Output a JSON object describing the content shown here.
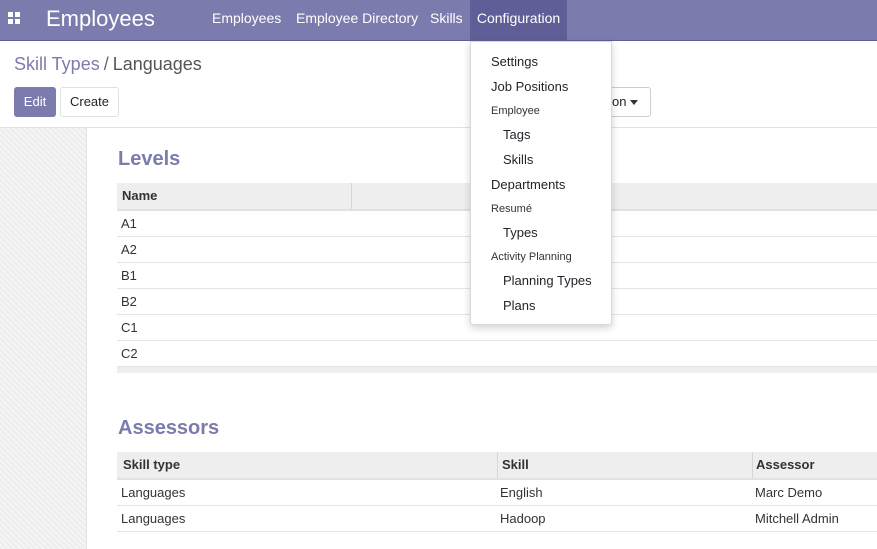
{
  "navbar": {
    "app_title": "Employees",
    "menu": [
      "Employees",
      "Employee Directory",
      "Skills",
      "Configuration"
    ],
    "active_menu": "Configuration"
  },
  "breadcrumb": {
    "parent": "Skill Types",
    "separator": "/",
    "current": "Languages"
  },
  "buttons": {
    "edit": "Edit",
    "create": "Create",
    "action_partial": "on"
  },
  "levels": {
    "title": "Levels",
    "columns": [
      "Name"
    ],
    "rows": [
      "A1",
      "A2",
      "B1",
      "B2",
      "C1",
      "C2"
    ]
  },
  "assessors": {
    "title": "Assessors",
    "columns": [
      "Skill type",
      "Skill",
      "Assessor"
    ],
    "rows": [
      [
        "Languages",
        "English",
        "Marc Demo"
      ],
      [
        "Languages",
        "Hadoop",
        "Mitchell Admin"
      ]
    ]
  },
  "config_menu": {
    "items": [
      {
        "type": "item",
        "label": "Settings"
      },
      {
        "type": "item",
        "label": "Job Positions"
      },
      {
        "type": "header",
        "label": "Employee"
      },
      {
        "type": "subitem",
        "label": "Tags"
      },
      {
        "type": "subitem",
        "label": "Skills"
      },
      {
        "type": "item",
        "label": "Departments"
      },
      {
        "type": "header",
        "label": "Resumé"
      },
      {
        "type": "subitem",
        "label": "Types"
      },
      {
        "type": "header",
        "label": "Activity Planning"
      },
      {
        "type": "subitem",
        "label": "Planning Types"
      },
      {
        "type": "subitem",
        "label": "Plans"
      }
    ]
  },
  "colors": {
    "brand": "#7c7bad",
    "brand_dark": "#5f5e97"
  },
  "icons": {
    "apps": "apps-grid-icon",
    "dropdown": "caret-down-icon"
  }
}
